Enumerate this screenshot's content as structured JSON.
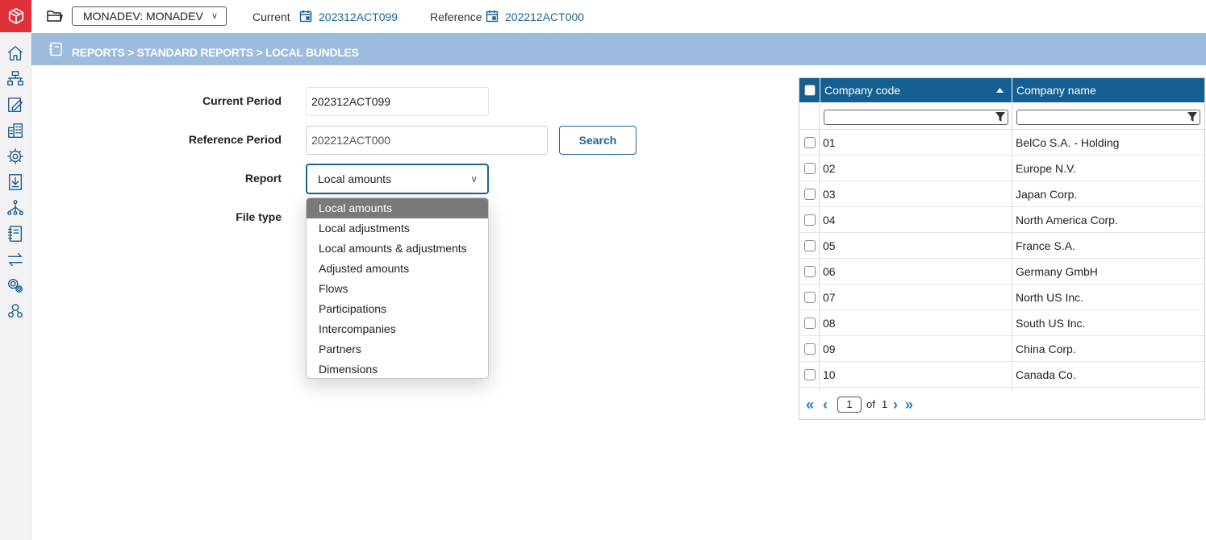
{
  "header": {
    "environment": "MONADEV: MONADEV",
    "current_label": "Current",
    "current_period": "202312ACT099",
    "reference_label": "Reference",
    "reference_period": "202212ACT000"
  },
  "breadcrumb": "REPORTS > STANDARD REPORTS > LOCAL BUNDLES",
  "form": {
    "current_period_label": "Current Period",
    "current_period_value": "202312ACT099",
    "reference_period_label": "Reference Period",
    "reference_period_value": "202212ACT000",
    "search_label": "Search",
    "report_label": "Report",
    "report_value": "Local amounts",
    "file_type_label": "File type"
  },
  "report_options": [
    "Local amounts",
    "Local adjustments",
    "Local amounts & adjustments",
    "Adjusted amounts",
    "Flows",
    "Participations",
    "Intercompanies",
    "Partners",
    "Dimensions"
  ],
  "grid": {
    "columns": [
      "Company code",
      "Company name"
    ],
    "sort_indicator": "ascending",
    "rows": [
      {
        "code": "01",
        "name": "BelCo S.A. - Holding"
      },
      {
        "code": "02",
        "name": "Europe N.V."
      },
      {
        "code": "03",
        "name": "Japan Corp."
      },
      {
        "code": "04",
        "name": "North America Corp."
      },
      {
        "code": "05",
        "name": "France S.A."
      },
      {
        "code": "06",
        "name": "Germany GmbH"
      },
      {
        "code": "07",
        "name": "North US Inc."
      },
      {
        "code": "08",
        "name": "South US Inc."
      },
      {
        "code": "09",
        "name": "China Corp."
      },
      {
        "code": "10",
        "name": "Canada Co."
      }
    ],
    "pager": {
      "page": "1",
      "of_label": "of",
      "total": "1"
    }
  },
  "sidebar_icons": [
    "home-icon",
    "hierarchy-icon",
    "edit-icon",
    "buildings-icon",
    "settings-network-icon",
    "import-icon",
    "tree-icon",
    "notebook-icon",
    "transfer-icon",
    "gears-icon",
    "users-icon"
  ],
  "colors": {
    "brand_red": "#e0303a",
    "primary_blue": "#145e91",
    "breadcrumb_bg": "#9dbbdc",
    "link": "#1d6496"
  }
}
